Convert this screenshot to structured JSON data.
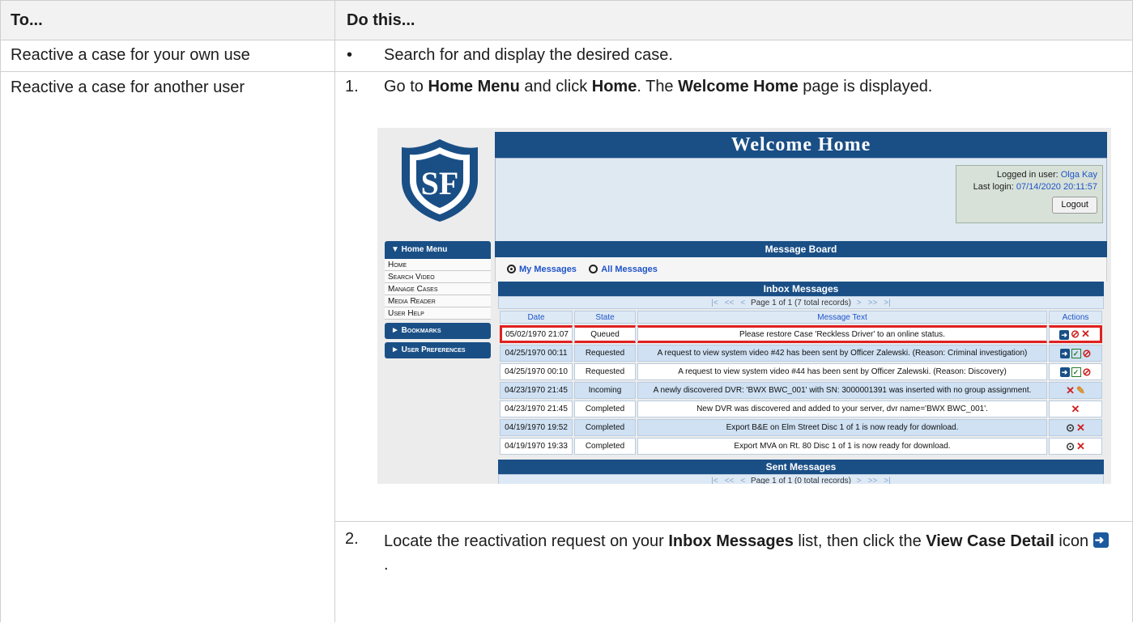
{
  "header": {
    "col1": "To...",
    "col2": "Do this..."
  },
  "row1": {
    "task": "Reactive a case for your own use",
    "bullet": "•",
    "action": "Search for and display the desired case."
  },
  "row2": {
    "task": "Reactive a case for another user",
    "step1": {
      "num": "1.",
      "p1": "Go to ",
      "b1": "Home Menu",
      "p2": " and click ",
      "b2": "Home",
      "p3": ". The ",
      "b3": "Welcome Home",
      "p4": " page is displayed."
    },
    "step2": {
      "num": "2.",
      "p1": "Locate the reactivation request on your ",
      "b1": "Inbox Messages",
      "p2": " list, then click the ",
      "b2": "View Case Detail",
      "p3": " icon ",
      "p4": "."
    }
  },
  "screenshot": {
    "title": "Welcome Home",
    "login": {
      "user_label": "Logged in user: ",
      "user": "Olga Kay",
      "last_label": "Last login: ",
      "last": "07/14/2020 20:11:57",
      "logout": "Logout"
    },
    "sidebar": {
      "menu_head": "▼ Home Menu",
      "items": [
        "Home",
        "Search Video",
        "Manage Cases",
        "Media Reader",
        "User Help"
      ],
      "bookmarks": "► Bookmarks",
      "prefs": "► User Preferences"
    },
    "board_title": "Message Board",
    "radio_my": "My Messages",
    "radio_all": "All Messages",
    "inbox_title": "Inbox Messages",
    "inbox_pager": "Page 1 of 1 (7 total records)",
    "sent_title": "Sent Messages",
    "sent_pager": "Page 1 of 1 (0 total records)",
    "columns": [
      "Date",
      "State",
      "Message Text",
      "Actions"
    ],
    "rows": [
      {
        "date": "05/02/1970 21:07",
        "state": "Queued",
        "text": "Please restore Case 'Reckless Driver' to an online status."
      },
      {
        "date": "04/25/1970 00:11",
        "state": "Requested",
        "text": "A request to view system video #42 has been sent by Officer Zalewski. (Reason: Criminal investigation)"
      },
      {
        "date": "04/25/1970 00:10",
        "state": "Requested",
        "text": "A request to view system video #44 has been sent by Officer Zalewski. (Reason: Discovery)"
      },
      {
        "date": "04/23/1970 21:45",
        "state": "Incoming",
        "text": "A newly discovered DVR: 'BWX BWC_001' with SN: 3000001391 was inserted with no group assignment."
      },
      {
        "date": "04/23/1970 21:45",
        "state": "Completed",
        "text": "New DVR was discovered and added to your server, dvr name='BWX BWC_001'."
      },
      {
        "date": "04/19/1970 19:52",
        "state": "Completed",
        "text": "Export B&E on Elm Street Disc 1 of 1 is now ready for download."
      },
      {
        "date": "04/19/1970 19:33",
        "state": "Completed",
        "text": "Export MVA on Rt. 80 Disc 1 of 1 is now ready for download."
      }
    ]
  },
  "colors": {
    "nav_blue": "#1a4f86",
    "highlight": "#e02020",
    "link_blue": "#1f54c8"
  }
}
